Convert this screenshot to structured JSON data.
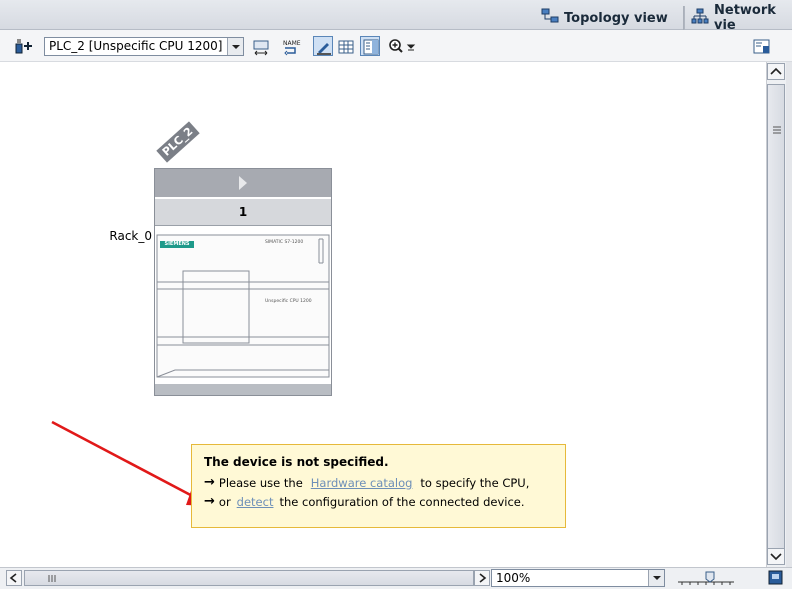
{
  "tabs": {
    "topology_view": "Topology view",
    "network_view": "Network vie"
  },
  "toolbar": {
    "device_select_value": "PLC_2 [Unspecific CPU 1200]"
  },
  "device": {
    "name_tag": "PLC_2",
    "rack_label": "Rack_0",
    "slot_number": "1",
    "brand": "SIEMENS",
    "series_label": "SIMATIC S7-1200",
    "cpu_label": "Unspecific CPU 1200"
  },
  "info": {
    "title": "The device is not specified.",
    "line1_prefix": "Please use the",
    "line1_link": "Hardware catalog",
    "line1_suffix": "to specify the CPU,",
    "line2_prefix": "or",
    "line2_link": "detect",
    "line2_suffix": "the configuration of the connected device.",
    "arrow_glyph": "→"
  },
  "bottom": {
    "zoom_value": "100%"
  },
  "colors": {
    "annotation_arrow": "#e11919",
    "info_background": "#fff9d6",
    "info_border": "#e6b93a",
    "link": "#6d8fb8",
    "siemens_badge": "#1f9a8a"
  },
  "icons": {
    "topology": "topology-icon",
    "network": "network-icon",
    "device_picker": "device-picker-icon",
    "zoom_in": "zoom-in-icon"
  }
}
